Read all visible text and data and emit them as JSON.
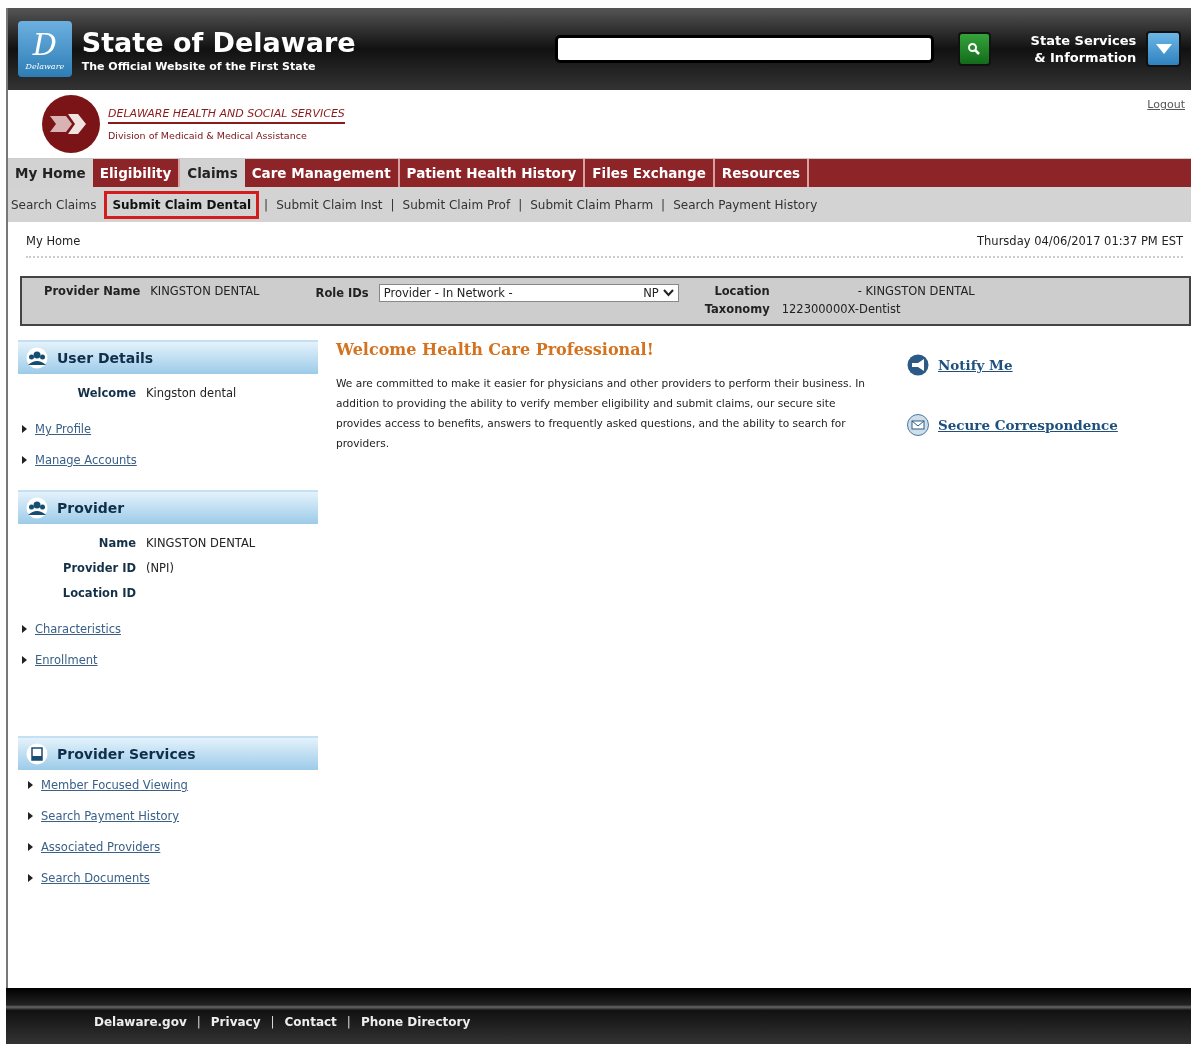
{
  "header": {
    "title": "State of Delaware",
    "subtitle": "The Official Website of the First State",
    "logo_letter": "D",
    "logo_text": "Delaware",
    "services": "State Services\n& Information"
  },
  "agency": {
    "name": "DELAWARE HEALTH AND SOCIAL SERVICES",
    "division": "Division of Medicaid & Medical Assistance",
    "logout": "Logout"
  },
  "tabs": [
    {
      "label": "My Home",
      "selected": true
    },
    {
      "label": "Eligibility",
      "selected": false
    },
    {
      "label": "Claims",
      "selected": true
    },
    {
      "label": "Care Management",
      "selected": false
    },
    {
      "label": "Patient Health History",
      "selected": false
    },
    {
      "label": "Files Exchange",
      "selected": false
    },
    {
      "label": "Resources",
      "selected": false
    }
  ],
  "subnav": [
    {
      "label": "Search Claims",
      "selected": false
    },
    {
      "label": "Submit Claim Dental",
      "selected": true
    },
    {
      "label": "Submit Claim Inst",
      "selected": false,
      "separator": "|"
    },
    {
      "label": "Submit Claim Prof",
      "selected": false,
      "separator": "|"
    },
    {
      "label": "Submit Claim Pharm",
      "selected": false,
      "separator": "|"
    },
    {
      "label": "Search Payment History",
      "selected": false,
      "separator": "|"
    }
  ],
  "breadcrumb": "My Home",
  "datetime": "Thursday 04/06/2017 01:37 PM EST",
  "provider_bar": {
    "provider_name_label": "Provider Name",
    "provider_name": "KINGSTON DENTAL",
    "role_label": "Role IDs",
    "role_value": "Provider - In Network -",
    "role_code": "NP",
    "location_label": "Location",
    "location": "- KINGSTON DENTAL",
    "taxonomy_label": "Taxonomy",
    "taxonomy": "122300000X-Dentist"
  },
  "sidebar": [
    {
      "title": "User Details",
      "kind": "people",
      "fields": [
        {
          "label": "Welcome",
          "value": "Kingston dental"
        }
      ],
      "links": [
        "My Profile",
        "Manage Accounts"
      ]
    },
    {
      "title": "Provider",
      "kind": "people",
      "fields": [
        {
          "label": "Name",
          "value": "KINGSTON DENTAL"
        },
        {
          "label": "Provider ID",
          "value": "(NPI)"
        },
        {
          "label": "Location ID"
        }
      ],
      "links": [
        "Characteristics",
        "Enrollment"
      ]
    },
    {
      "title": "Provider Services",
      "kind": "document",
      "links": [
        "Member Focused Viewing",
        "Search Payment History",
        "Associated Providers",
        "Search Documents"
      ]
    }
  ],
  "welcome": {
    "heading": "Welcome Health Care Professional!",
    "text": "We are committed to make it easier for physicians and other providers to perform their business. In addition to providing the ability to verify member eligibility and submit claims, our secure site provides access to benefits, answers to frequently asked questions, and the ability to search for providers."
  },
  "quick_links": [
    {
      "label": "Notify Me",
      "kind": "megaphone"
    },
    {
      "label": "Secure Correspondence",
      "kind": "envelope"
    }
  ],
  "footer": [
    {
      "label": "Delaware.gov"
    },
    {
      "label": "Privacy",
      "separator": "|"
    },
    {
      "label": "Contact",
      "separator": "|"
    },
    {
      "label": "Phone Directory",
      "separator": "|"
    }
  ]
}
